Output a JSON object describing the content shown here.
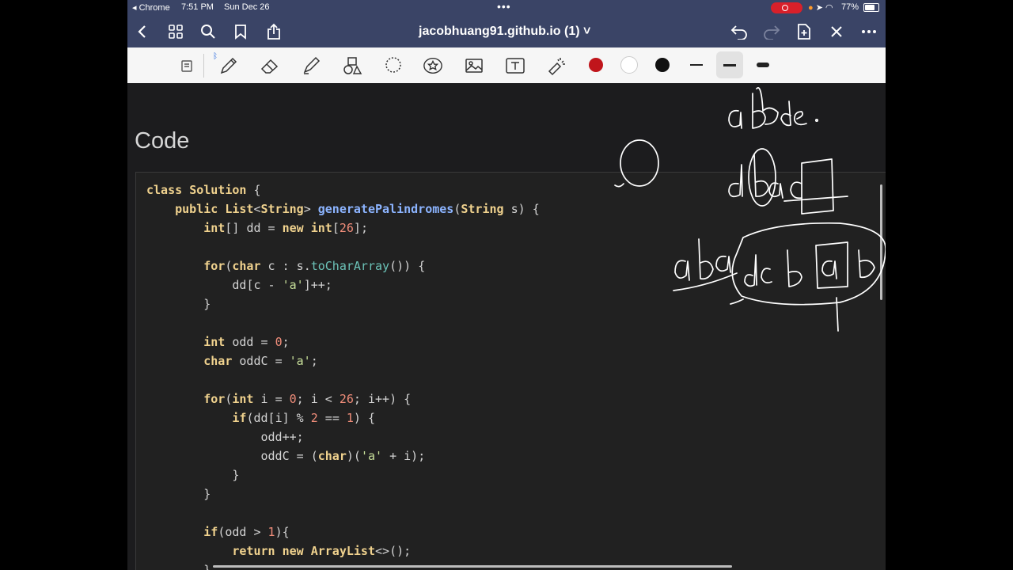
{
  "status_bar": {
    "back_app": "◂ Chrome",
    "time": "7:51 PM",
    "date": "Sun Dec 26",
    "battery_text": "77%",
    "battery_level": 0.77
  },
  "nav": {
    "title": "jacobhuang91.github.io (1) ˅"
  },
  "toolbar": {
    "pen_colors": [
      "#c0151b",
      "#ffffff",
      "#111111"
    ],
    "selected_stroke": "medium"
  },
  "page": {
    "heading": "Code",
    "code_lines": [
      "class Solution {",
      "    public List<String> generatePalindromes(String s) {",
      "        int[] dd = new int[26];",
      "",
      "        for(char c : s.toCharArray()) {",
      "            dd[c - 'a']++;",
      "        }",
      "",
      "        int odd = 0;",
      "        char oddC = 'a';",
      "",
      "        for(int i = 0; i < 26; i++) {",
      "            if(dd[i] % 2 == 1) {",
      "                odd++;",
      "                oddC = (char)('a' + i);",
      "            }",
      "        }",
      "",
      "        if(odd > 1){",
      "            return new ArrayList<>();",
      "        }"
    ]
  },
  "handwriting": {
    "notes": [
      "a",
      "abde.",
      "dbac",
      "aba",
      "dcbab"
    ]
  }
}
